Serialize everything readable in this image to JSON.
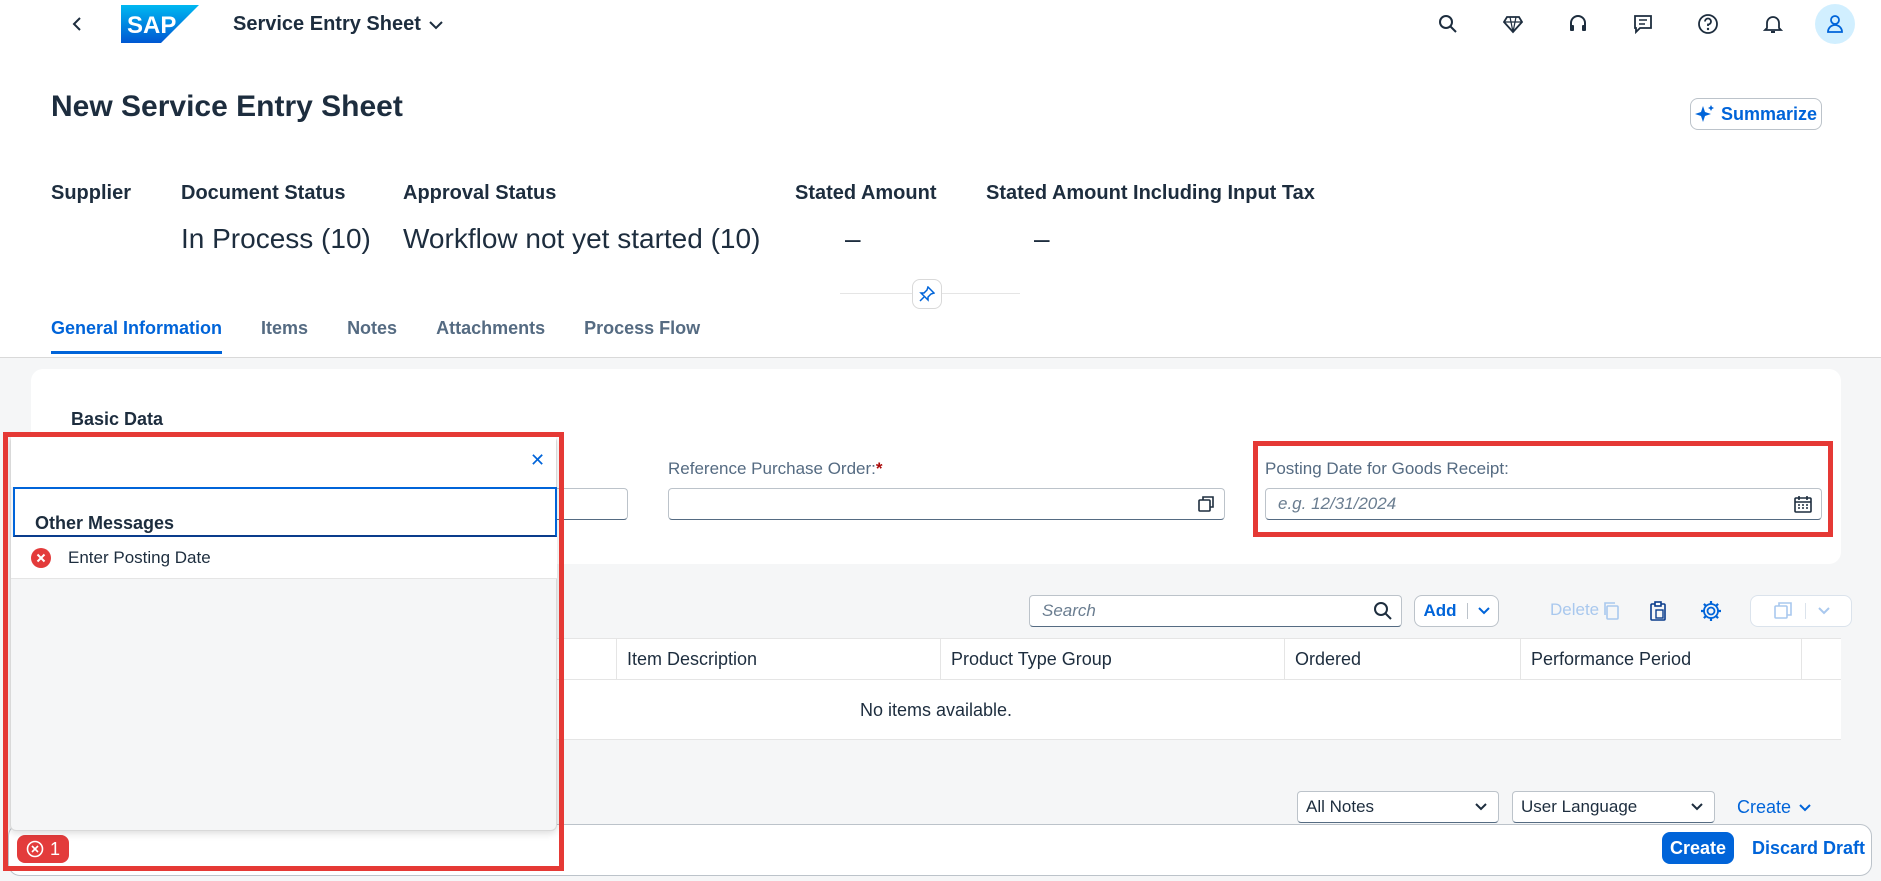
{
  "shell": {
    "logo_text": "SAP",
    "app_title": "Service Entry Sheet",
    "icons": [
      "search-icon",
      "diamond-icon",
      "headset-icon",
      "feedback-icon",
      "help-icon",
      "bell-icon",
      "user-icon"
    ]
  },
  "header": {
    "title": "New Service Entry Sheet",
    "summarize_label": "Summarize",
    "kpis": [
      {
        "label": "Supplier",
        "value": ""
      },
      {
        "label": "Document Status",
        "value": "In Process (10)"
      },
      {
        "label": "Approval Status",
        "value": "Workflow not yet started (10)"
      },
      {
        "label": "Stated Amount",
        "value": "–"
      },
      {
        "label": "Stated Amount Including Input Tax",
        "value": "–"
      }
    ]
  },
  "tabs": [
    "General Information",
    "Items",
    "Notes",
    "Attachments",
    "Process Flow"
  ],
  "basic_data": {
    "title": "Basic Data",
    "reference_po_label": "Reference Purchase Order:",
    "required_mark": "*",
    "posting_date_label": "Posting Date for Goods Receipt:",
    "posting_date_placeholder": "e.g. 12/31/2024"
  },
  "items_table": {
    "search_placeholder": "Search",
    "add_label": "Add",
    "delete_label": "Delete",
    "columns": [
      "Item Description",
      "Product Type Group",
      "Ordered",
      "Performance Period"
    ],
    "empty_text": "No items available."
  },
  "notes": {
    "filter_value": "All Notes",
    "language_value": "User Language",
    "create_label": "Create"
  },
  "footer": {
    "create_label": "Create",
    "discard_label": "Discard Draft",
    "error_count": "1"
  },
  "message_popover": {
    "group_label": "Other Messages",
    "messages": [
      {
        "type": "error",
        "text": "Enter Posting Date"
      }
    ]
  },
  "colors": {
    "accent": "#0064d9",
    "error": "#e33b3b",
    "highlight": "#e53935"
  }
}
